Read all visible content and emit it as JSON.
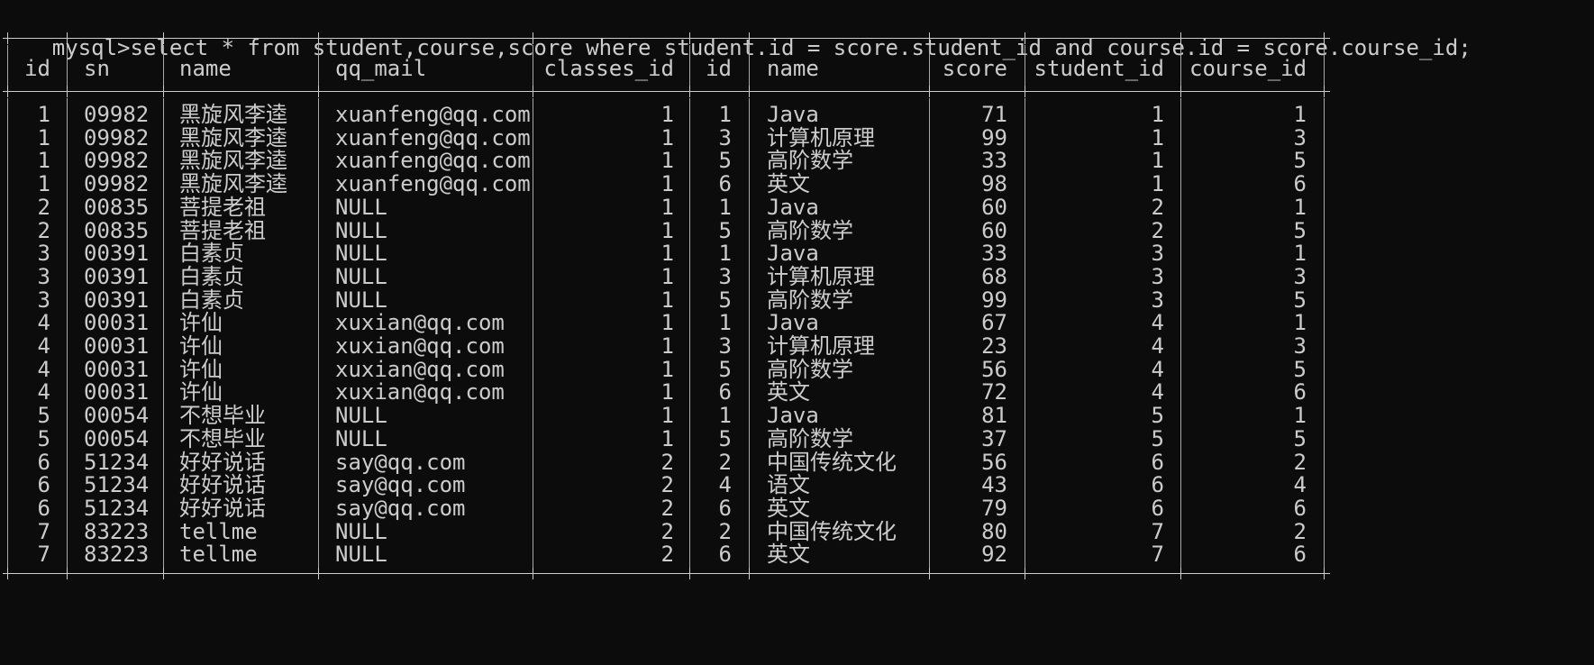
{
  "prompt": "mysql>",
  "command": "select * from student,course,score where student.id = score.student_id and course.id = score.course_id;",
  "headers": [
    "id",
    "sn",
    "name",
    "qq_mail",
    "classes_id",
    "id",
    "name",
    "score",
    "student_id",
    "course_id"
  ],
  "rows": [
    [
      "1",
      "09982",
      "黑旋风李逵",
      "xuanfeng@qq.com",
      "1",
      "1",
      "Java",
      "71",
      "1",
      "1"
    ],
    [
      "1",
      "09982",
      "黑旋风李逵",
      "xuanfeng@qq.com",
      "1",
      "3",
      "计算机原理",
      "99",
      "1",
      "3"
    ],
    [
      "1",
      "09982",
      "黑旋风李逵",
      "xuanfeng@qq.com",
      "1",
      "5",
      "高阶数学",
      "33",
      "1",
      "5"
    ],
    [
      "1",
      "09982",
      "黑旋风李逵",
      "xuanfeng@qq.com",
      "1",
      "6",
      "英文",
      "98",
      "1",
      "6"
    ],
    [
      "2",
      "00835",
      "菩提老祖",
      "NULL",
      "1",
      "1",
      "Java",
      "60",
      "2",
      "1"
    ],
    [
      "2",
      "00835",
      "菩提老祖",
      "NULL",
      "1",
      "5",
      "高阶数学",
      "60",
      "2",
      "5"
    ],
    [
      "3",
      "00391",
      "白素贞",
      "NULL",
      "1",
      "1",
      "Java",
      "33",
      "3",
      "1"
    ],
    [
      "3",
      "00391",
      "白素贞",
      "NULL",
      "1",
      "3",
      "计算机原理",
      "68",
      "3",
      "3"
    ],
    [
      "3",
      "00391",
      "白素贞",
      "NULL",
      "1",
      "5",
      "高阶数学",
      "99",
      "3",
      "5"
    ],
    [
      "4",
      "00031",
      "许仙",
      "xuxian@qq.com",
      "1",
      "1",
      "Java",
      "67",
      "4",
      "1"
    ],
    [
      "4",
      "00031",
      "许仙",
      "xuxian@qq.com",
      "1",
      "3",
      "计算机原理",
      "23",
      "4",
      "3"
    ],
    [
      "4",
      "00031",
      "许仙",
      "xuxian@qq.com",
      "1",
      "5",
      "高阶数学",
      "56",
      "4",
      "5"
    ],
    [
      "4",
      "00031",
      "许仙",
      "xuxian@qq.com",
      "1",
      "6",
      "英文",
      "72",
      "4",
      "6"
    ],
    [
      "5",
      "00054",
      "不想毕业",
      "NULL",
      "1",
      "1",
      "Java",
      "81",
      "5",
      "1"
    ],
    [
      "5",
      "00054",
      "不想毕业",
      "NULL",
      "1",
      "5",
      "高阶数学",
      "37",
      "5",
      "5"
    ],
    [
      "6",
      "51234",
      "好好说话",
      "say@qq.com",
      "2",
      "2",
      "中国传统文化",
      "56",
      "6",
      "2"
    ],
    [
      "6",
      "51234",
      "好好说话",
      "say@qq.com",
      "2",
      "4",
      "语文",
      "43",
      "6",
      "4"
    ],
    [
      "6",
      "51234",
      "好好说话",
      "say@qq.com",
      "2",
      "6",
      "英文",
      "79",
      "6",
      "6"
    ],
    [
      "7",
      "83223",
      "tellme",
      "NULL",
      "2",
      "2",
      "中国传统文化",
      "80",
      "7",
      "2"
    ],
    [
      "7",
      "83223",
      "tellme",
      "NULL",
      "2",
      "6",
      "英文",
      "92",
      "7",
      "6"
    ]
  ],
  "colors": {
    "background": "#0c0c0c",
    "text": "#cccccc"
  }
}
